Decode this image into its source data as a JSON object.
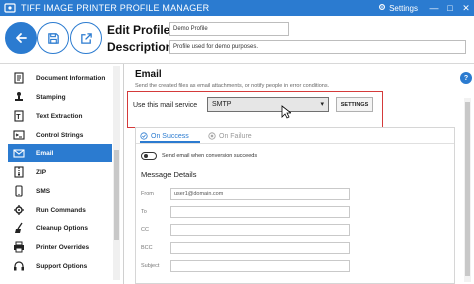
{
  "titlebar": {
    "title": "TIFF IMAGE PRINTER PROFILE MANAGER",
    "logo_text": "ø",
    "settings_label": "Settings",
    "buttons": [
      "—",
      "□",
      "✕"
    ]
  },
  "toolbar": {
    "edit_profile_label": "Edit Profile -",
    "edit_profile_value": "Demo Profile",
    "description_label": "Description",
    "description_value": "Profile used for demo purposes."
  },
  "sidebar": {
    "items": [
      {
        "label": "Document Information",
        "icon": "document-info-icon"
      },
      {
        "label": "Stamping",
        "icon": "stamp-icon"
      },
      {
        "label": "Text Extraction",
        "icon": "text-extraction-icon"
      },
      {
        "label": "Control Strings",
        "icon": "control-strings-icon"
      },
      {
        "label": "Email",
        "icon": "email-icon",
        "active": true
      },
      {
        "label": "ZIP",
        "icon": "zip-icon"
      },
      {
        "label": "SMS",
        "icon": "sms-icon"
      },
      {
        "label": "Run Commands",
        "icon": "run-commands-icon"
      },
      {
        "label": "Cleanup Options",
        "icon": "cleanup-icon"
      },
      {
        "label": "Printer Overrides",
        "icon": "printer-icon"
      },
      {
        "label": "Support Options",
        "icon": "support-icon"
      }
    ]
  },
  "main": {
    "title": "Email",
    "description": "Send the created files as email attachments, or notify people in error conditions.",
    "help": "?",
    "service_label": "Use this mail service",
    "service_value": "SMTP",
    "settings_button": "SETTINGS",
    "tabs": [
      {
        "label": "On Success",
        "active": true
      },
      {
        "label": "On Failure",
        "active": false
      }
    ],
    "toggle_label": "Send email when conversion succeeds",
    "message_details_title": "Message Details",
    "fields": [
      {
        "label": "From",
        "value": "user1@domain.com"
      },
      {
        "label": "To",
        "value": ""
      },
      {
        "label": "CC",
        "value": ""
      },
      {
        "label": "BCC",
        "value": ""
      },
      {
        "label": "Subject",
        "value": ""
      }
    ]
  },
  "colors": {
    "accent": "#2b7bd0",
    "highlight_border": "#d43a3a"
  }
}
